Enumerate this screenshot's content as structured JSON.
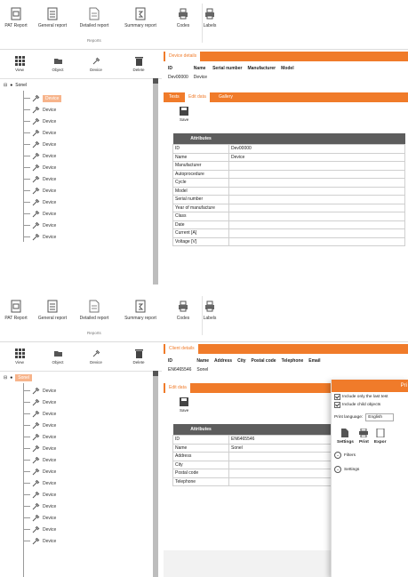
{
  "ribbon": {
    "buttons": [
      "PAT Report",
      "General report",
      "Detailed report",
      "Summary report",
      "Codes",
      "Labels"
    ],
    "group_label": "Reports"
  },
  "tree_tools": [
    "View",
    "Object",
    "Device",
    "Delete"
  ],
  "tree": {
    "root_label": "Sonel",
    "device_label": "Device",
    "top_count": 13,
    "bottom_count": 14
  },
  "device_details": {
    "panel_title": "Device details",
    "columns": [
      "ID",
      "Name",
      "Serial number",
      "Manufacturer",
      "Model"
    ],
    "row": [
      "Dev00000",
      "Device",
      "",
      "",
      ""
    ],
    "tabs": [
      "Tests",
      "Edit data",
      "Gallery"
    ],
    "active_tab": "Edit data",
    "save_label": "Save",
    "attributes_header": "Attributes",
    "attributes": [
      {
        "k": "ID",
        "v": "Dev00000"
      },
      {
        "k": "Name",
        "v": "Device"
      },
      {
        "k": "Manufacturer",
        "v": ""
      },
      {
        "k": "Autoprocedure",
        "v": ""
      },
      {
        "k": "Cycle",
        "v": ""
      },
      {
        "k": "Model",
        "v": ""
      },
      {
        "k": "Serial number",
        "v": ""
      },
      {
        "k": "Year of manufacture",
        "v": ""
      },
      {
        "k": "Class",
        "v": ""
      },
      {
        "k": "Date",
        "v": ""
      },
      {
        "k": "Current [A]",
        "v": ""
      },
      {
        "k": "Voltage [V]",
        "v": ""
      }
    ]
  },
  "client_details": {
    "panel_title": "Client details",
    "columns": [
      "ID",
      "Name",
      "Address",
      "City",
      "Postal code",
      "Telephone",
      "Email"
    ],
    "row": [
      "EN6465546",
      "Sonel",
      "",
      "",
      "",
      "",
      ""
    ],
    "tabs": [
      "Edit data"
    ],
    "save_label": "Save",
    "attributes_header": "Attributes",
    "attributes": [
      {
        "k": "ID",
        "v": "EN6465546"
      },
      {
        "k": "Name",
        "v": "Sonel"
      },
      {
        "k": "Address",
        "v": ""
      },
      {
        "k": "City",
        "v": ""
      },
      {
        "k": "Postal code",
        "v": ""
      },
      {
        "k": "Telephone",
        "v": ""
      }
    ]
  },
  "print_panel": {
    "title": "Pri",
    "opt_last_test": "Include only the last test",
    "opt_child": "Include child objects",
    "language_label": "Print language:",
    "language_value": "English",
    "actions": [
      "Settings",
      "Print",
      "Expor"
    ],
    "filters_label": "Filters",
    "settings_label": "Settings"
  },
  "colors": {
    "accent": "#f07b2a",
    "header_gray": "#5d5d5d",
    "selection": "#f7b48b"
  }
}
